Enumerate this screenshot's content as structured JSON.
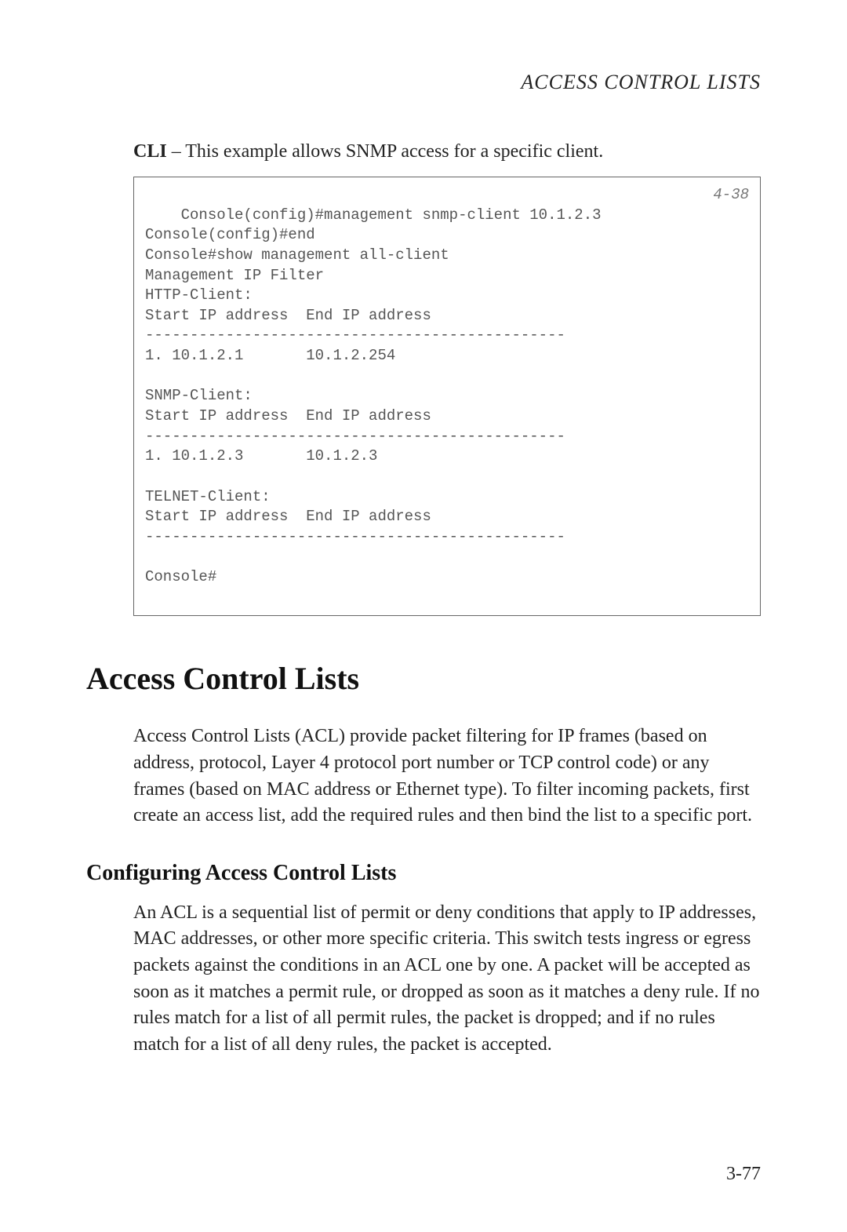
{
  "header": {
    "running_title": "ACCESS CONTROL LISTS"
  },
  "intro": {
    "label": "CLI",
    "text": " – This example allows SNMP access for a specific client."
  },
  "cli": {
    "reference": "4-38",
    "output": "Console(config)#management snmp-client 10.1.2.3\nConsole(config)#end\nConsole#show management all-client\nManagement IP Filter\nHTTP-Client:\nStart IP address  End IP address\n-----------------------------------------------\n1. 10.1.2.1       10.1.2.254\n\nSNMP-Client:\nStart IP address  End IP address\n-----------------------------------------------\n1. 10.1.2.3       10.1.2.3\n\nTELNET-Client:\nStart IP address  End IP address\n-----------------------------------------------\n\nConsole#"
  },
  "section": {
    "heading": "Access Control Lists",
    "paragraph": "Access Control Lists (ACL) provide packet filtering for IP frames (based on address, protocol, Layer 4 protocol port number or TCP control code) or any frames (based on MAC address or Ethernet type). To filter incoming packets, first create an access list, add the required rules and then bind the list to a specific port."
  },
  "subsection": {
    "heading": "Configuring Access Control Lists",
    "paragraph": "An ACL is a sequential list of permit or deny conditions that apply to IP addresses, MAC addresses, or other more specific criteria. This switch tests ingress or egress packets against the conditions in an ACL one by one. A packet will be accepted as soon as it matches a permit rule, or dropped as soon as it matches a deny rule. If no rules match for a list of all permit rules, the packet is dropped; and if no rules match for a list of all deny rules, the packet is accepted."
  },
  "page_number": "3-77"
}
